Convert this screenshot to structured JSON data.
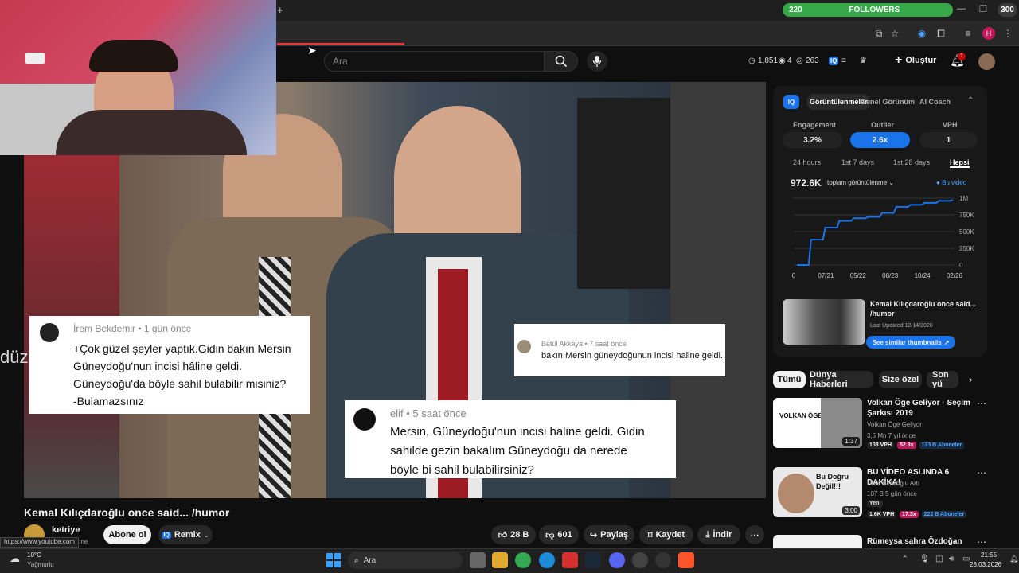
{
  "browser": {
    "followers_level": "220",
    "followers_label": "FOLLOWERS",
    "followers_count": "300",
    "status_url": "https://www.youtube.com"
  },
  "header": {
    "search_placeholder": "Ara",
    "stat_views": "1,851",
    "stat_eye": "4",
    "stat_viewers": "263",
    "create_label": "Oluştur",
    "notif_count": "1"
  },
  "video": {
    "title": "Kemal Kılıçdaroğlu once said... /humor",
    "side_text": "düz",
    "channel_name": "ketriye",
    "channel_subs": "one",
    "subscribe_label": "Abone ol",
    "remix_label": "Remix",
    "likes": "28 B",
    "dislikes": "601",
    "share_label": "Paylaş",
    "save_label": "Kaydet",
    "download_label": "İndir"
  },
  "comments": [
    {
      "author": "İrem Bekdemir",
      "time": "1 gün önce",
      "text": [
        "+Çok güzel şeyler yaptık.Gidin bakın Mersin",
        "Güneydoğu'nun incisi hâline geldi.",
        "Güneydoğu'da böyle sahil bulabilir misiniz?",
        "-Bulamazsınız"
      ]
    },
    {
      "author": "Betül Akkaya",
      "time": "7 saat önce",
      "text": [
        "bakın Mersin güneydoğunun incisi haline geldi."
      ]
    },
    {
      "author": "elif",
      "time": "5 saat önce",
      "text": [
        "Mersin, Güneydoğu'nun incisi haline geldi.  Gidin",
        "sahilde gezin bakalım Güneydoğu da nerede",
        "böyle bi sahil bulabilirsiniz?"
      ]
    }
  ],
  "iq": {
    "tabs": [
      "Görüntülenmeler",
      "Genel Görünüm",
      "AI Coach"
    ],
    "metrics": [
      {
        "label": "Engagement",
        "value": "3.2%"
      },
      {
        "label": "Outlier",
        "value": "2.6x"
      },
      {
        "label": "VPH",
        "value": "1"
      }
    ],
    "ranges": [
      "24 hours",
      "1st 7 days",
      "1st 28 days",
      "Hepsi"
    ],
    "total_views": "972.6K",
    "views_dropdown": "toplam görüntülenme",
    "legend": "Bu video",
    "thumb_title": "Kemal Kılıçdaroğlu once said... /humor",
    "last_updated": "Last Updated 12/14/2020",
    "similar_label": "See similar thumbnails",
    "accent": "#1a73e8"
  },
  "chart_data": {
    "type": "line",
    "x_ticks": [
      "0",
      "07/21",
      "05/22",
      "08/23",
      "10/24",
      "02/26"
    ],
    "y_ticks": [
      "1M",
      "750K",
      "500K",
      "250K",
      "0"
    ],
    "ylim": [
      0,
      1000000
    ],
    "series": [
      {
        "values": [
          0,
          380000,
          560000,
          660000,
          700000,
          720000,
          780000,
          870000,
          900000,
          930000,
          960000,
          972600
        ]
      }
    ]
  },
  "chips": [
    "Tümü",
    "Dünya Haberleri",
    "Size özel",
    "Son yü"
  ],
  "recommendations": [
    {
      "title": "Volkan Öge Geliyor - Seçim Şarkısı 2019",
      "channel": "Volkan Öge Geliyor",
      "meta": "3,5 Mn   7 yıl önce",
      "duration": "1:37",
      "vph": "108 VPH",
      "outlier": "52.3x",
      "subs": "123 B Aboneler",
      "thumb_text": "VOLKAN ÖGE"
    },
    {
      "title": "BU VİDEO ASLINDA 6 DAKİKA!",
      "channel": "Uras Benlioğlu Artı",
      "meta": "107 B   5 gün önce",
      "new": "Yeni",
      "duration": "3:00",
      "vph": "1.6K VPH",
      "outlier": "17.3x",
      "subs": "222 B Aboneler",
      "thumb_text": "Bu Doğru Değil!!!"
    },
    {
      "title": "Rümeysa sahra Özdoğan :bu",
      "channel": "",
      "meta": "",
      "duration": "",
      "vph": "",
      "outlier": "",
      "subs": "",
      "thumb_text": ""
    }
  ],
  "taskbar": {
    "temp": "10°C",
    "weather": "Yağmurlu",
    "search": "Ara",
    "time": "21:55",
    "date": "28.03.2026"
  }
}
